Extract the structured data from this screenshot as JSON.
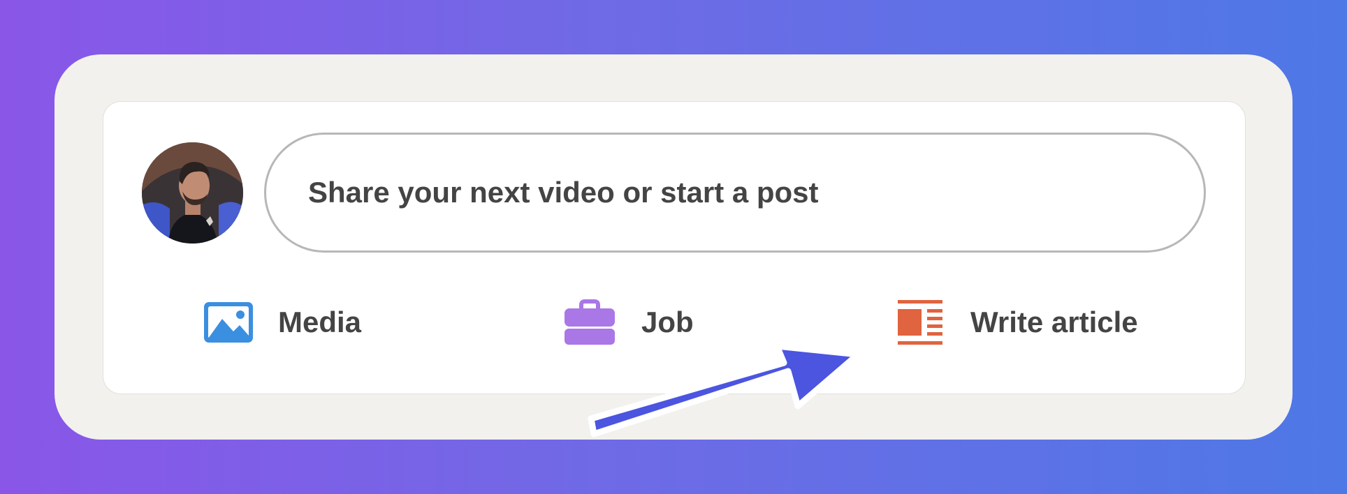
{
  "composer": {
    "avatar_icon": "user-avatar-photo",
    "input_placeholder": "Share your next video or start a post"
  },
  "actions": [
    {
      "label": "Media",
      "icon": "image-icon",
      "color": "#3b8fe0"
    },
    {
      "label": "Job",
      "icon": "briefcase-icon",
      "color": "#a977e6"
    },
    {
      "label": "Write article",
      "icon": "article-icon",
      "color": "#e0643f"
    }
  ],
  "annotation": {
    "icon": "arrow-icon",
    "color": "#4b55e0"
  },
  "colors": {
    "background_start": "#8a56e8",
    "background_end": "#4e78e6",
    "card_outer": "#f2f1ee",
    "card_inner": "#ffffff",
    "text": "#444444"
  }
}
